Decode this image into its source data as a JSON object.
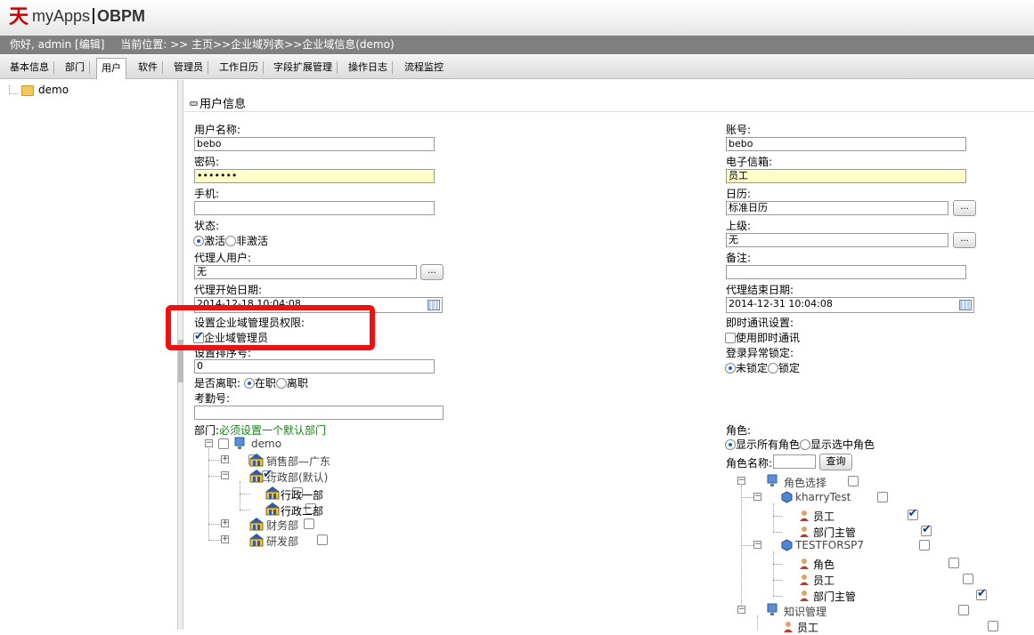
{
  "header": {
    "logo_text": "myApps",
    "product": "OBPM"
  },
  "infobar": {
    "greeting": "你好, admin [编辑]",
    "location": "当前位置:  >> 主页>>企业域列表>>企业域信息(demo)"
  },
  "tabs": [
    "基本信息",
    "部门",
    "用户",
    "软件",
    "管理员",
    "工作日历",
    "字段扩展管理",
    "操作日志",
    "流程监控"
  ],
  "active_tab": "用户",
  "sidebar": {
    "tree_root": "demo"
  },
  "section_title": "用户信息",
  "left": {
    "username_label": "用户名称:",
    "username_value": "bebo",
    "password_label": "密码:",
    "password_value": "•••••••",
    "phone_label": "手机:",
    "phone_value": "",
    "status_label": "状态:",
    "status_active": "激活",
    "status_inactive": "非激活",
    "proxy_user_label": "代理人用户:",
    "proxy_user_value": "无",
    "proxy_start_label": "代理开始日期:",
    "proxy_start_value": "2014-12-18 10:04:08",
    "admin_perm_label": "设置企业域管理员权限:",
    "admin_checkbox_label": "企业域管理员",
    "sort_label": "设置排序号:",
    "sort_value": "0",
    "resigned_label": "是否离职:",
    "resigned_on": "在职",
    "resigned_off": "离职",
    "attendance_label": "考勤号:",
    "attendance_value": "",
    "dept_label": "部门:",
    "dept_hint": "必须设置一个默认部门",
    "dept_tree": {
      "root": "demo",
      "items": [
        "销售部—广东",
        "行政部(默认)",
        "行政一部",
        "行政二部",
        "财务部",
        "研发部"
      ]
    }
  },
  "right": {
    "account_label": "账号:",
    "account_value": "bebo",
    "email_label": "电子信箱:",
    "email_value": "员工",
    "calendar_label": "日历:",
    "calendar_value": "标准日历",
    "superior_label": "上级:",
    "superior_value": "无",
    "remark_label": "备注:",
    "remark_value": "",
    "proxy_end_label": "代理结束日期:",
    "proxy_end_value": "2014-12-31 10:04:08",
    "im_label": "即时通讯设置:",
    "im_checkbox_label": "使用即时通讯",
    "lock_label": "登录异常锁定:",
    "lock_off": "未锁定",
    "lock_on": "锁定",
    "role_label": "角色:",
    "role_show_all": "显示所有角色",
    "role_show_selected": "显示选中角色",
    "role_name_label": "角色名称:",
    "role_query_button": "查询",
    "role_tree": {
      "root": "角色选择",
      "app1": "kharryTest",
      "app1_roles": [
        "员工",
        "部门主管"
      ],
      "app2": "TESTFORSP7",
      "app2_roles": [
        "角色",
        "员工",
        "部门主管"
      ],
      "app3": "知识管理",
      "app3_roles": [
        "员工"
      ]
    }
  },
  "button_dots": "..."
}
